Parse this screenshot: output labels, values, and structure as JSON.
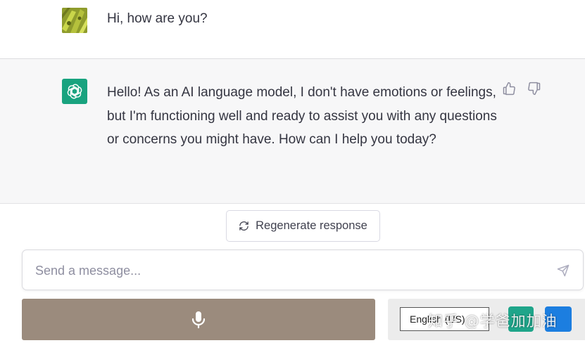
{
  "conversation": {
    "user_message": "Hi, how are you?",
    "assistant_message": "Hello! As an AI language model, I don't have emotions or feelings, but I'm functioning well and ready to assist you with any questions or concerns you might have. How can I help you today?"
  },
  "actions": {
    "regenerate_label": "Regenerate response"
  },
  "composer": {
    "placeholder": "Send a message..."
  },
  "voice": {
    "language": "English (US)"
  },
  "watermark": "知乎 @学爸加加油",
  "colors": {
    "assistant_avatar_bg": "#19a37f",
    "mic_bar_bg": "#9b8b7d",
    "green_button": "#1fa58a",
    "blue_button": "#1c7ee0"
  },
  "icons": {
    "user_avatar": "user-avatar-image",
    "assistant_avatar": "openai-logo-icon",
    "thumbs_up": "thumbs-up-icon",
    "thumbs_down": "thumbs-down-icon",
    "regenerate": "refresh-icon",
    "send": "send-icon",
    "mic": "microphone-icon"
  }
}
